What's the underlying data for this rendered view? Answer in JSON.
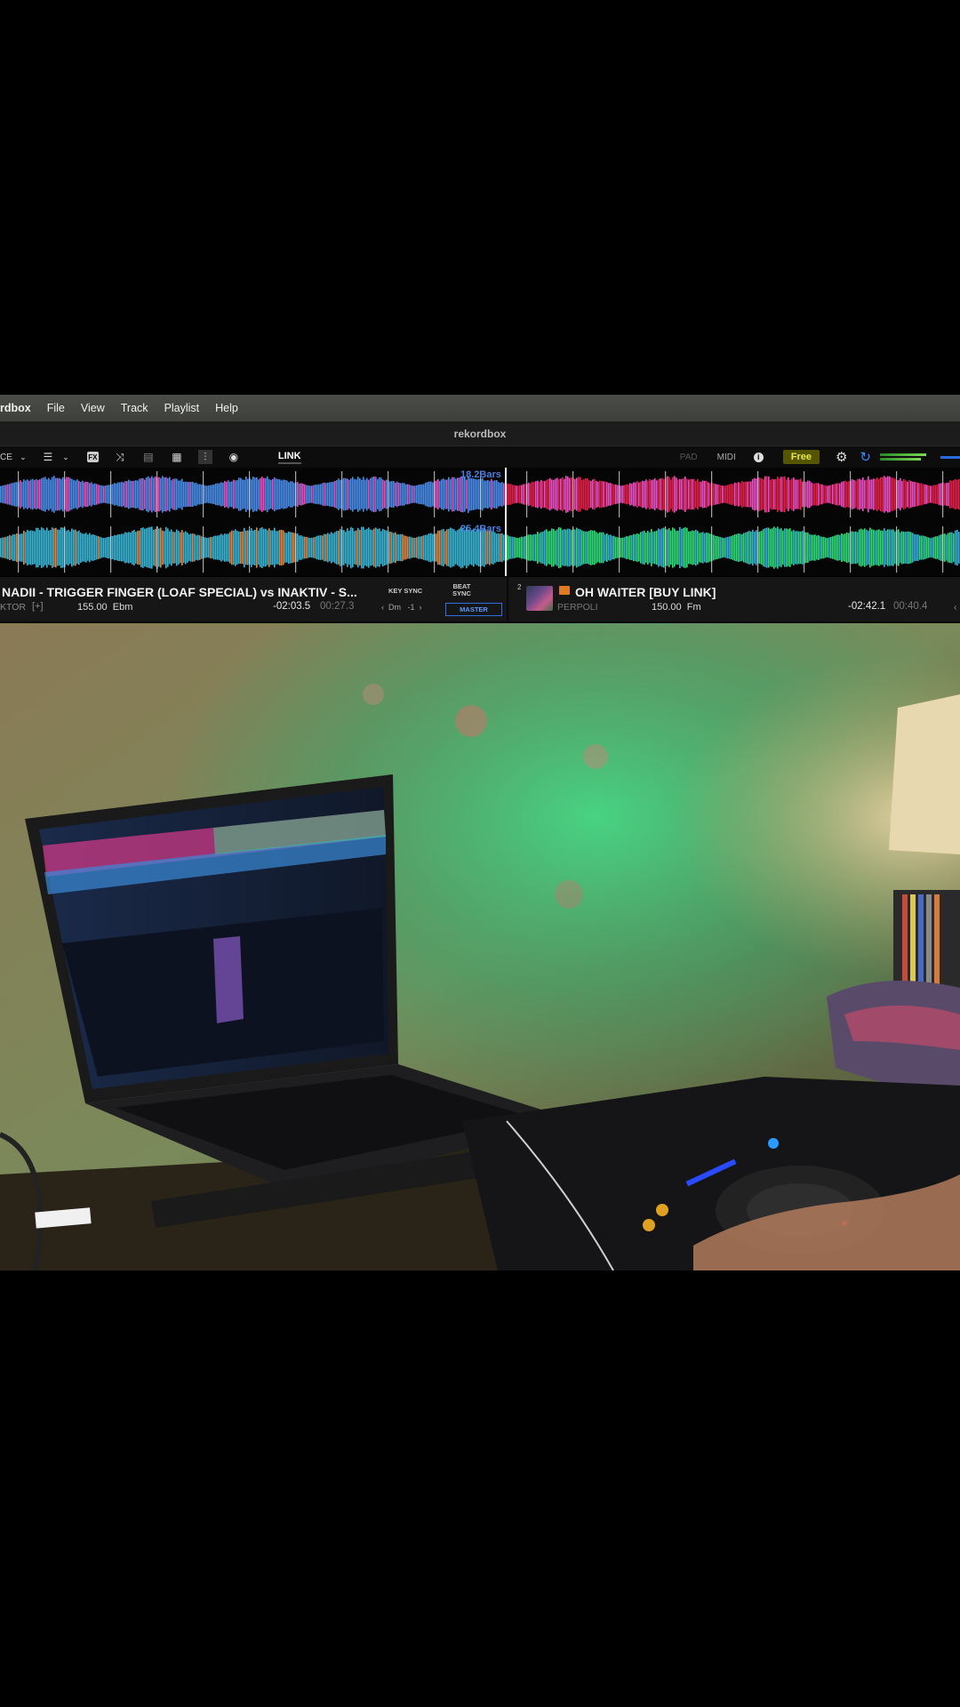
{
  "menubar": {
    "app_name": "rdbox",
    "items": [
      "File",
      "View",
      "Track",
      "Playlist",
      "Help"
    ]
  },
  "window": {
    "title": "rekordbox"
  },
  "toolbar": {
    "mode_label": "CE",
    "link_label": "LINK",
    "pad_label": "PAD",
    "midi_label": "MIDI",
    "free_label": "Free",
    "icons": [
      "menu-icon",
      "fx-icon",
      "shuffle-icon",
      "sampler-icon",
      "grid-icon",
      "mixer-icon",
      "record-icon"
    ]
  },
  "waveform": {
    "deck_a_bars": "18.2Bars",
    "deck_b_bars": "25.4Bars"
  },
  "deck_a": {
    "title": "NADII - TRIGGER FINGER (LOAF SPECIAL) vs INAKTIV - S...",
    "artist": "KTOR",
    "add_label": "[+]",
    "bpm_key": "155.00  Ebm",
    "remaining": "-02:03.5",
    "elapsed": "00:27.3",
    "key_sync_label": "KEY SYNC",
    "key_control": "‹  Dm   -1  ›",
    "beat_sync_label": "BEAT\nSYNC",
    "master_label": "MASTER"
  },
  "deck_b": {
    "number": "2",
    "title": "OH WAITER [BUY LINK]",
    "artist": "PERPOLI",
    "bpm_key": "150.00  Fm",
    "remaining": "-02:42.1",
    "elapsed": "00:40.4",
    "arrow": "‹"
  },
  "colors": {
    "deck_a_wave": "#4a8ff0",
    "deck_a_wave_highlight": "#f050c8",
    "deck_b_wave_red": "#e8204a",
    "deck_b_wave_green": "#30e07a",
    "accent_blue": "#3a7fff",
    "free_badge": "#e8e84a"
  }
}
